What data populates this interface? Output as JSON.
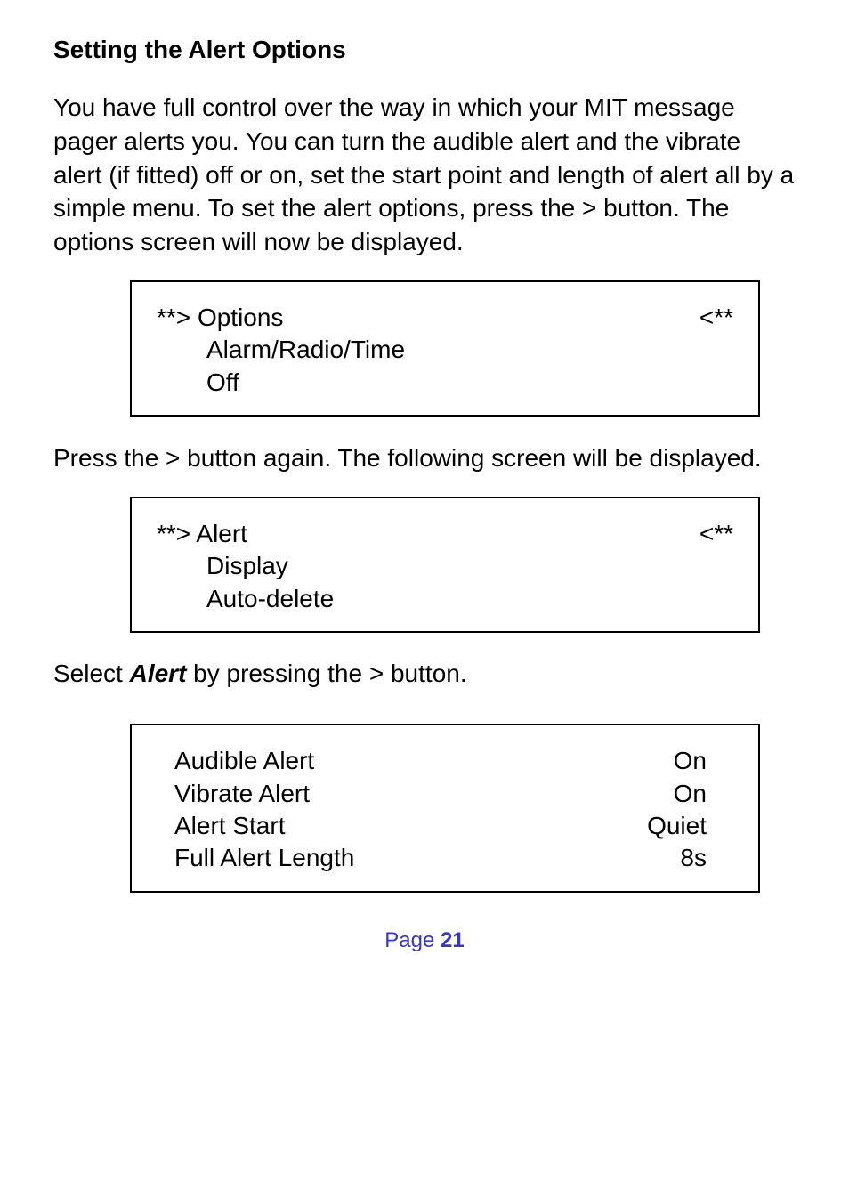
{
  "heading": "Setting the Alert Options",
  "para1": "You have full control over the way in which your MIT message pager alerts you.  You can turn the audible alert and the vibrate alert (if fitted) off or on, set the start point and length of alert all by a simple menu.  To set the alert options, press the > button.  The options screen will now be displayed.",
  "screen1": {
    "mark_left": "**> ",
    "line1": "Options",
    "mark_right": "<**",
    "line2": "Alarm/Radio/Time",
    "line3": "Off"
  },
  "para2": "Press the > button again.  The following screen will be displayed.",
  "screen2": {
    "mark_left": "**> ",
    "line1": "Alert",
    "mark_right": "<**",
    "line2": "Display",
    "line3": "Auto-delete"
  },
  "select_pre": "Select ",
  "select_bold": "Alert",
  "select_post": " by pressing the > button.",
  "screen3": {
    "rows": [
      {
        "label": "Audible Alert",
        "value": "On"
      },
      {
        "label": "Vibrate Alert",
        "value": "On"
      },
      {
        "label": "Alert Start",
        "value": "Quiet"
      },
      {
        "label": "Full Alert Length",
        "value": "8s"
      }
    ]
  },
  "footer_text": "Page ",
  "footer_num": "21"
}
